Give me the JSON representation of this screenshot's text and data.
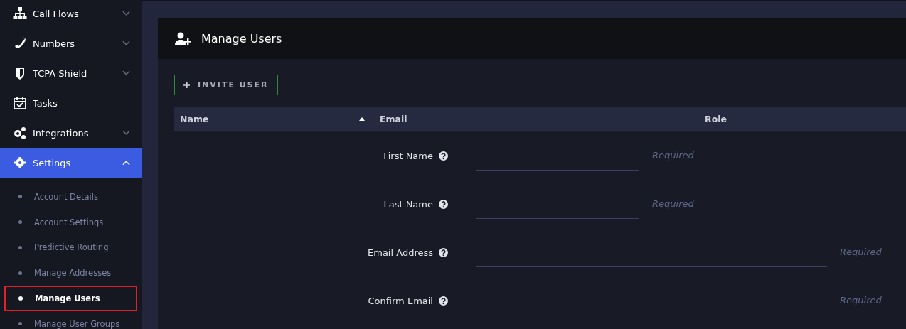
{
  "sidebar": {
    "items": [
      {
        "label": "Call Flows",
        "expandable": true,
        "expanded": false,
        "selected": false
      },
      {
        "label": "Numbers",
        "expandable": true,
        "expanded": false,
        "selected": false
      },
      {
        "label": "TCPA Shield",
        "expandable": true,
        "expanded": false,
        "selected": false
      },
      {
        "label": "Tasks",
        "expandable": false,
        "selected": false
      },
      {
        "label": "Integrations",
        "expandable": true,
        "expanded": false,
        "selected": false
      },
      {
        "label": "Settings",
        "expandable": true,
        "expanded": true,
        "selected": true,
        "children": [
          {
            "label": "Account Details",
            "selected": false,
            "outlined": false
          },
          {
            "label": "Account Settings",
            "selected": false,
            "outlined": false
          },
          {
            "label": "Predictive Routing",
            "selected": false,
            "outlined": false
          },
          {
            "label": "Manage Addresses",
            "selected": false,
            "outlined": false
          },
          {
            "label": "Manage Users",
            "selected": true,
            "outlined": true
          },
          {
            "label": "Manage User Groups",
            "selected": false,
            "outlined": false
          }
        ]
      }
    ]
  },
  "panel": {
    "title": "Manage Users",
    "invite_button": "INVITE USER",
    "table": {
      "columns": [
        {
          "label": "Name",
          "sorted": true
        },
        {
          "label": "Email",
          "sorted": false
        },
        {
          "label": "Role",
          "sorted": false
        }
      ]
    },
    "form": {
      "fields": [
        {
          "label": "First Name",
          "kind": "short",
          "hint": "Required"
        },
        {
          "label": "Last Name",
          "kind": "short",
          "hint": "Required"
        },
        {
          "label": "Email Address",
          "kind": "long",
          "hint": "Required"
        },
        {
          "label": "Confirm Email",
          "kind": "long",
          "hint": "Required"
        }
      ]
    }
  }
}
